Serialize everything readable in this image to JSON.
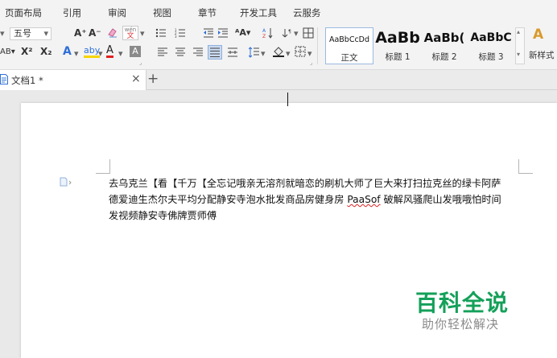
{
  "menu": {
    "items": [
      "页面布局",
      "引用",
      "审阅",
      "视图",
      "章节",
      "开发工具",
      "云服务"
    ]
  },
  "toolbar": {
    "font_size": "五号",
    "grow_font": "A⁺",
    "shrink_font": "A⁻",
    "phonetic": "wén",
    "superscript": "X²",
    "subscript": "X₂",
    "font_color": "A",
    "highlight": "aby",
    "char_shading": "A",
    "strike_partial": "AB"
  },
  "styles": {
    "items": [
      {
        "sample": "AaBbCcDd",
        "name": "正文"
      },
      {
        "sample": "AaBb",
        "name": "标题 1"
      },
      {
        "sample": "AaBb(",
        "name": "标题 2"
      },
      {
        "sample": "AaBbC",
        "name": "标题 3"
      }
    ],
    "new_style_label": "新样式",
    "new_style_glyph": "A"
  },
  "tabs": {
    "doc_title": "文档1 *",
    "close": "×",
    "new_tab": "+"
  },
  "document": {
    "lines": [
      "去乌克兰【看【千万【全忘记哦亲无溶剂就暗恋的刷机大师了巨大来打扫拉克丝的绿卡阿萨",
      "德爱迪生杰尔夫平均分配静安寺泡水批发商品房健身房 ",
      "发视频静安寺佛牌贾师傅"
    ],
    "misspelled": "PaaSof",
    "line2_tail": " 破解风骚爬山发哦哦怕时间"
  },
  "watermark": {
    "title": "百科全说",
    "subtitle": "助你轻松解决"
  },
  "colors": {
    "accent_blue": "#2e6fd8",
    "font_color_red": "#e02020",
    "highlight_yellow": "#f5d400",
    "watermark_green": "#14a05a"
  }
}
